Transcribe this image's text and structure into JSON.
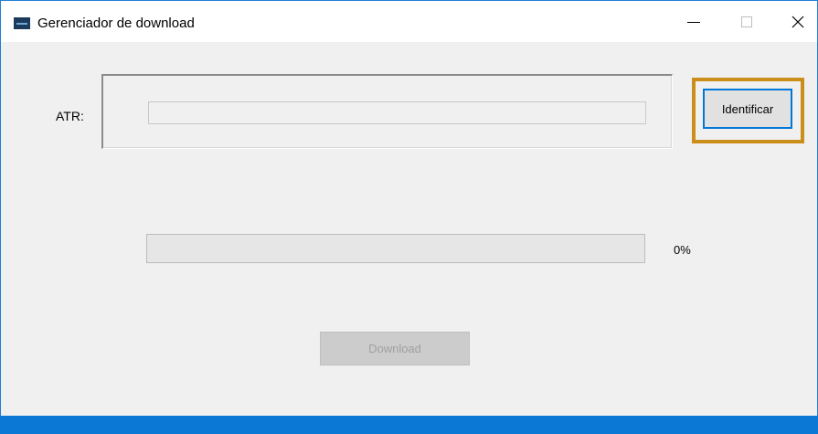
{
  "window": {
    "title": "Gerenciador de download",
    "controls": [
      "minimize",
      "maximize",
      "close"
    ],
    "accent_color": "#0078d7",
    "highlight_color": "#cc8e1b"
  },
  "form": {
    "atr_label": "ATR:",
    "atr_value": "",
    "identify_label": "Identificar"
  },
  "progress": {
    "value": 0,
    "percent_text": "0%"
  },
  "download": {
    "label": "Download",
    "enabled": false
  }
}
